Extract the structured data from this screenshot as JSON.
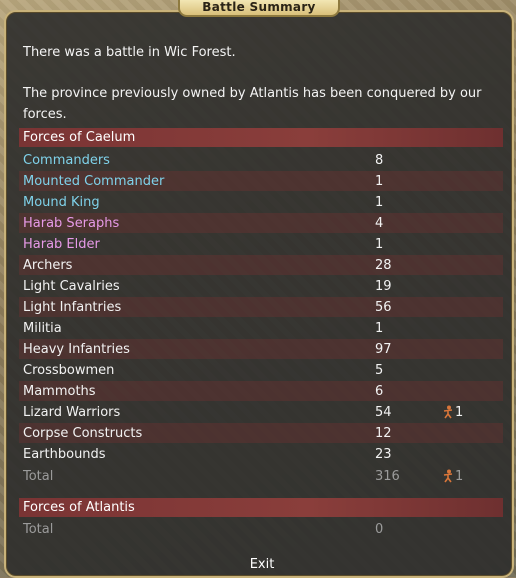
{
  "dialog": {
    "title": "Battle Summary",
    "message_line1": "There was a battle in Wic Forest.",
    "message_line2": "The province previously owned by Atlantis has been conquered by our forces.",
    "exit_label": "Exit"
  },
  "forces_caelum": {
    "header": "Forces of Caelum",
    "units": [
      {
        "name": "Commanders",
        "count": "8",
        "extra": ""
      },
      {
        "name": "Mounted Commander",
        "count": "1",
        "extra": ""
      },
      {
        "name": "Mound King",
        "count": "1",
        "extra": ""
      },
      {
        "name": "Harab Seraphs",
        "count": "4",
        "extra": ""
      },
      {
        "name": "Harab Elder",
        "count": "1",
        "extra": ""
      },
      {
        "name": "Archers",
        "count": "28",
        "extra": ""
      },
      {
        "name": "Light Cavalries",
        "count": "19",
        "extra": ""
      },
      {
        "name": "Light Infantries",
        "count": "56",
        "extra": ""
      },
      {
        "name": "Militia",
        "count": "1",
        "extra": ""
      },
      {
        "name": "Heavy Infantries",
        "count": "97",
        "extra": ""
      },
      {
        "name": "Crossbowmen",
        "count": "5",
        "extra": ""
      },
      {
        "name": "Mammoths",
        "count": "6",
        "extra": ""
      },
      {
        "name": "Lizard Warriors",
        "count": "54",
        "extra": "1"
      },
      {
        "name": "Corpse Constructs",
        "count": "12",
        "extra": ""
      },
      {
        "name": "Earthbounds",
        "count": "23",
        "extra": ""
      }
    ],
    "total_label": "Total",
    "total_count": "316",
    "total_extra": "1"
  },
  "forces_atlantis": {
    "header": "Forces of Atlantis",
    "total_label": "Total",
    "total_count": "0"
  },
  "colors": {
    "commander_text": "#7fd2ea",
    "sacred_text": "#e79ae8",
    "section_bg": "#7a3434",
    "border": "#c8b27a"
  },
  "icons": {
    "extra_marker": "casualty-figure-icon"
  }
}
